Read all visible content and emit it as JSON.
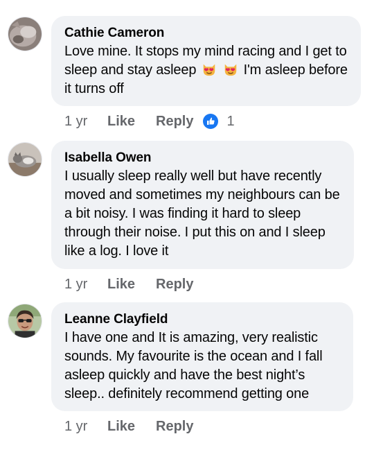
{
  "comments": [
    {
      "name": "Cathie Cameron",
      "text_part1": "Love mine. It stops my mind racing and I get to sleep and stay asleep",
      "emoji": "heart-eyes-cat-icon",
      "text_part2": "I'm asleep before it turns off",
      "time": "1 yr",
      "like_label": "Like",
      "reply_label": "Reply",
      "reaction_icon": "like-thumb-icon",
      "reaction_count": "1"
    },
    {
      "name": "Isabella Owen",
      "text": "I usually sleep really well but have recently moved and sometimes my neighbours can be a bit noisy. I was  finding it hard to sleep through their noise. I put this on and I sleep like a log. I love it",
      "time": "1 yr",
      "like_label": "Like",
      "reply_label": "Reply"
    },
    {
      "name": "Leanne Clayfield",
      "text": "I have one and It is amazing, very realistic sounds. My favourite is the ocean and I fall asleep quickly and have the best night’s sleep.. definitely recommend getting one",
      "time": "1 yr",
      "like_label": "Like",
      "reply_label": "Reply"
    }
  ],
  "colors": {
    "bubble": "#f0f2f5",
    "meta_text": "#65676b",
    "like_blue": "#1877f2"
  }
}
